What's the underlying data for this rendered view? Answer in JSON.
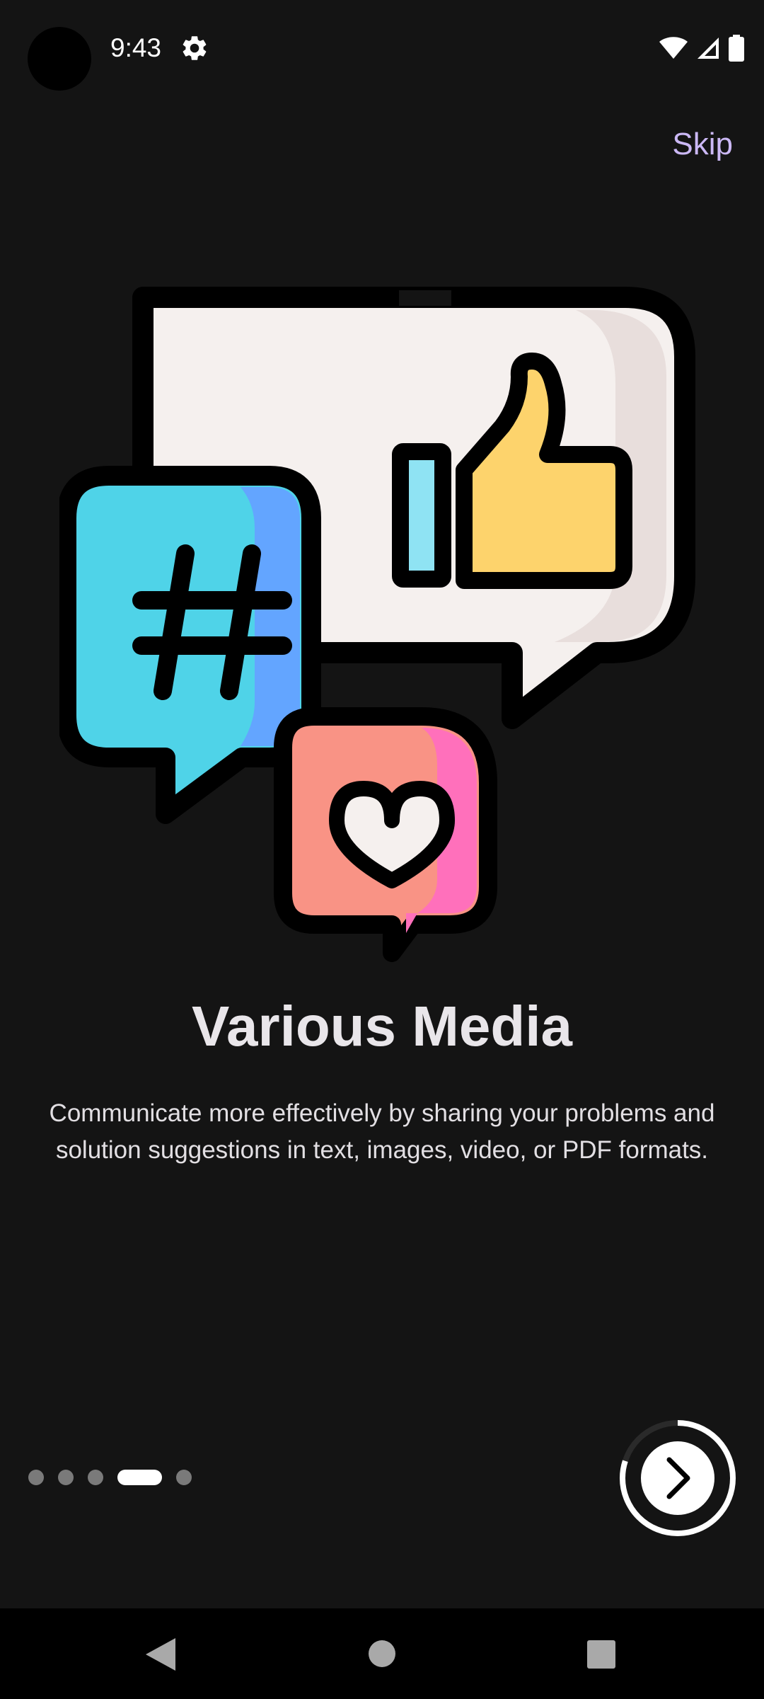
{
  "status_bar": {
    "time": "9:43",
    "icons": [
      "settings-gear-icon",
      "wifi-icon",
      "cellular-signal-icon",
      "battery-icon"
    ]
  },
  "header": {
    "skip_label": "Skip",
    "skip_color": "#cbb8f5"
  },
  "illustration": {
    "icons": [
      "hashtag-speech-bubble-icon",
      "thumbs-up-speech-bubble-icon",
      "heart-speech-bubble-icon"
    ],
    "colors": {
      "hashtag_bubble": "#4fd3e8",
      "hashtag_bubble_shade": "#63a5ff",
      "like_bubble": "#f5f0ee",
      "like_thumb": "#fdd36c",
      "like_cuff": "#8fe3f3",
      "heart_bubble": "#f99385",
      "heart_bubble_shade": "#ff70bb"
    }
  },
  "onboarding": {
    "title": "Various Media",
    "description": "Communicate more effectively by sharing your problems and solution suggestions in text, images, video, or PDF formats.",
    "page_count": 5,
    "current_page": 4,
    "progress_fraction": 0.8
  },
  "next_button": {
    "icon": "chevron-right-icon"
  },
  "nav_bar": {
    "icons": [
      "back-icon",
      "home-icon",
      "recents-icon"
    ]
  }
}
